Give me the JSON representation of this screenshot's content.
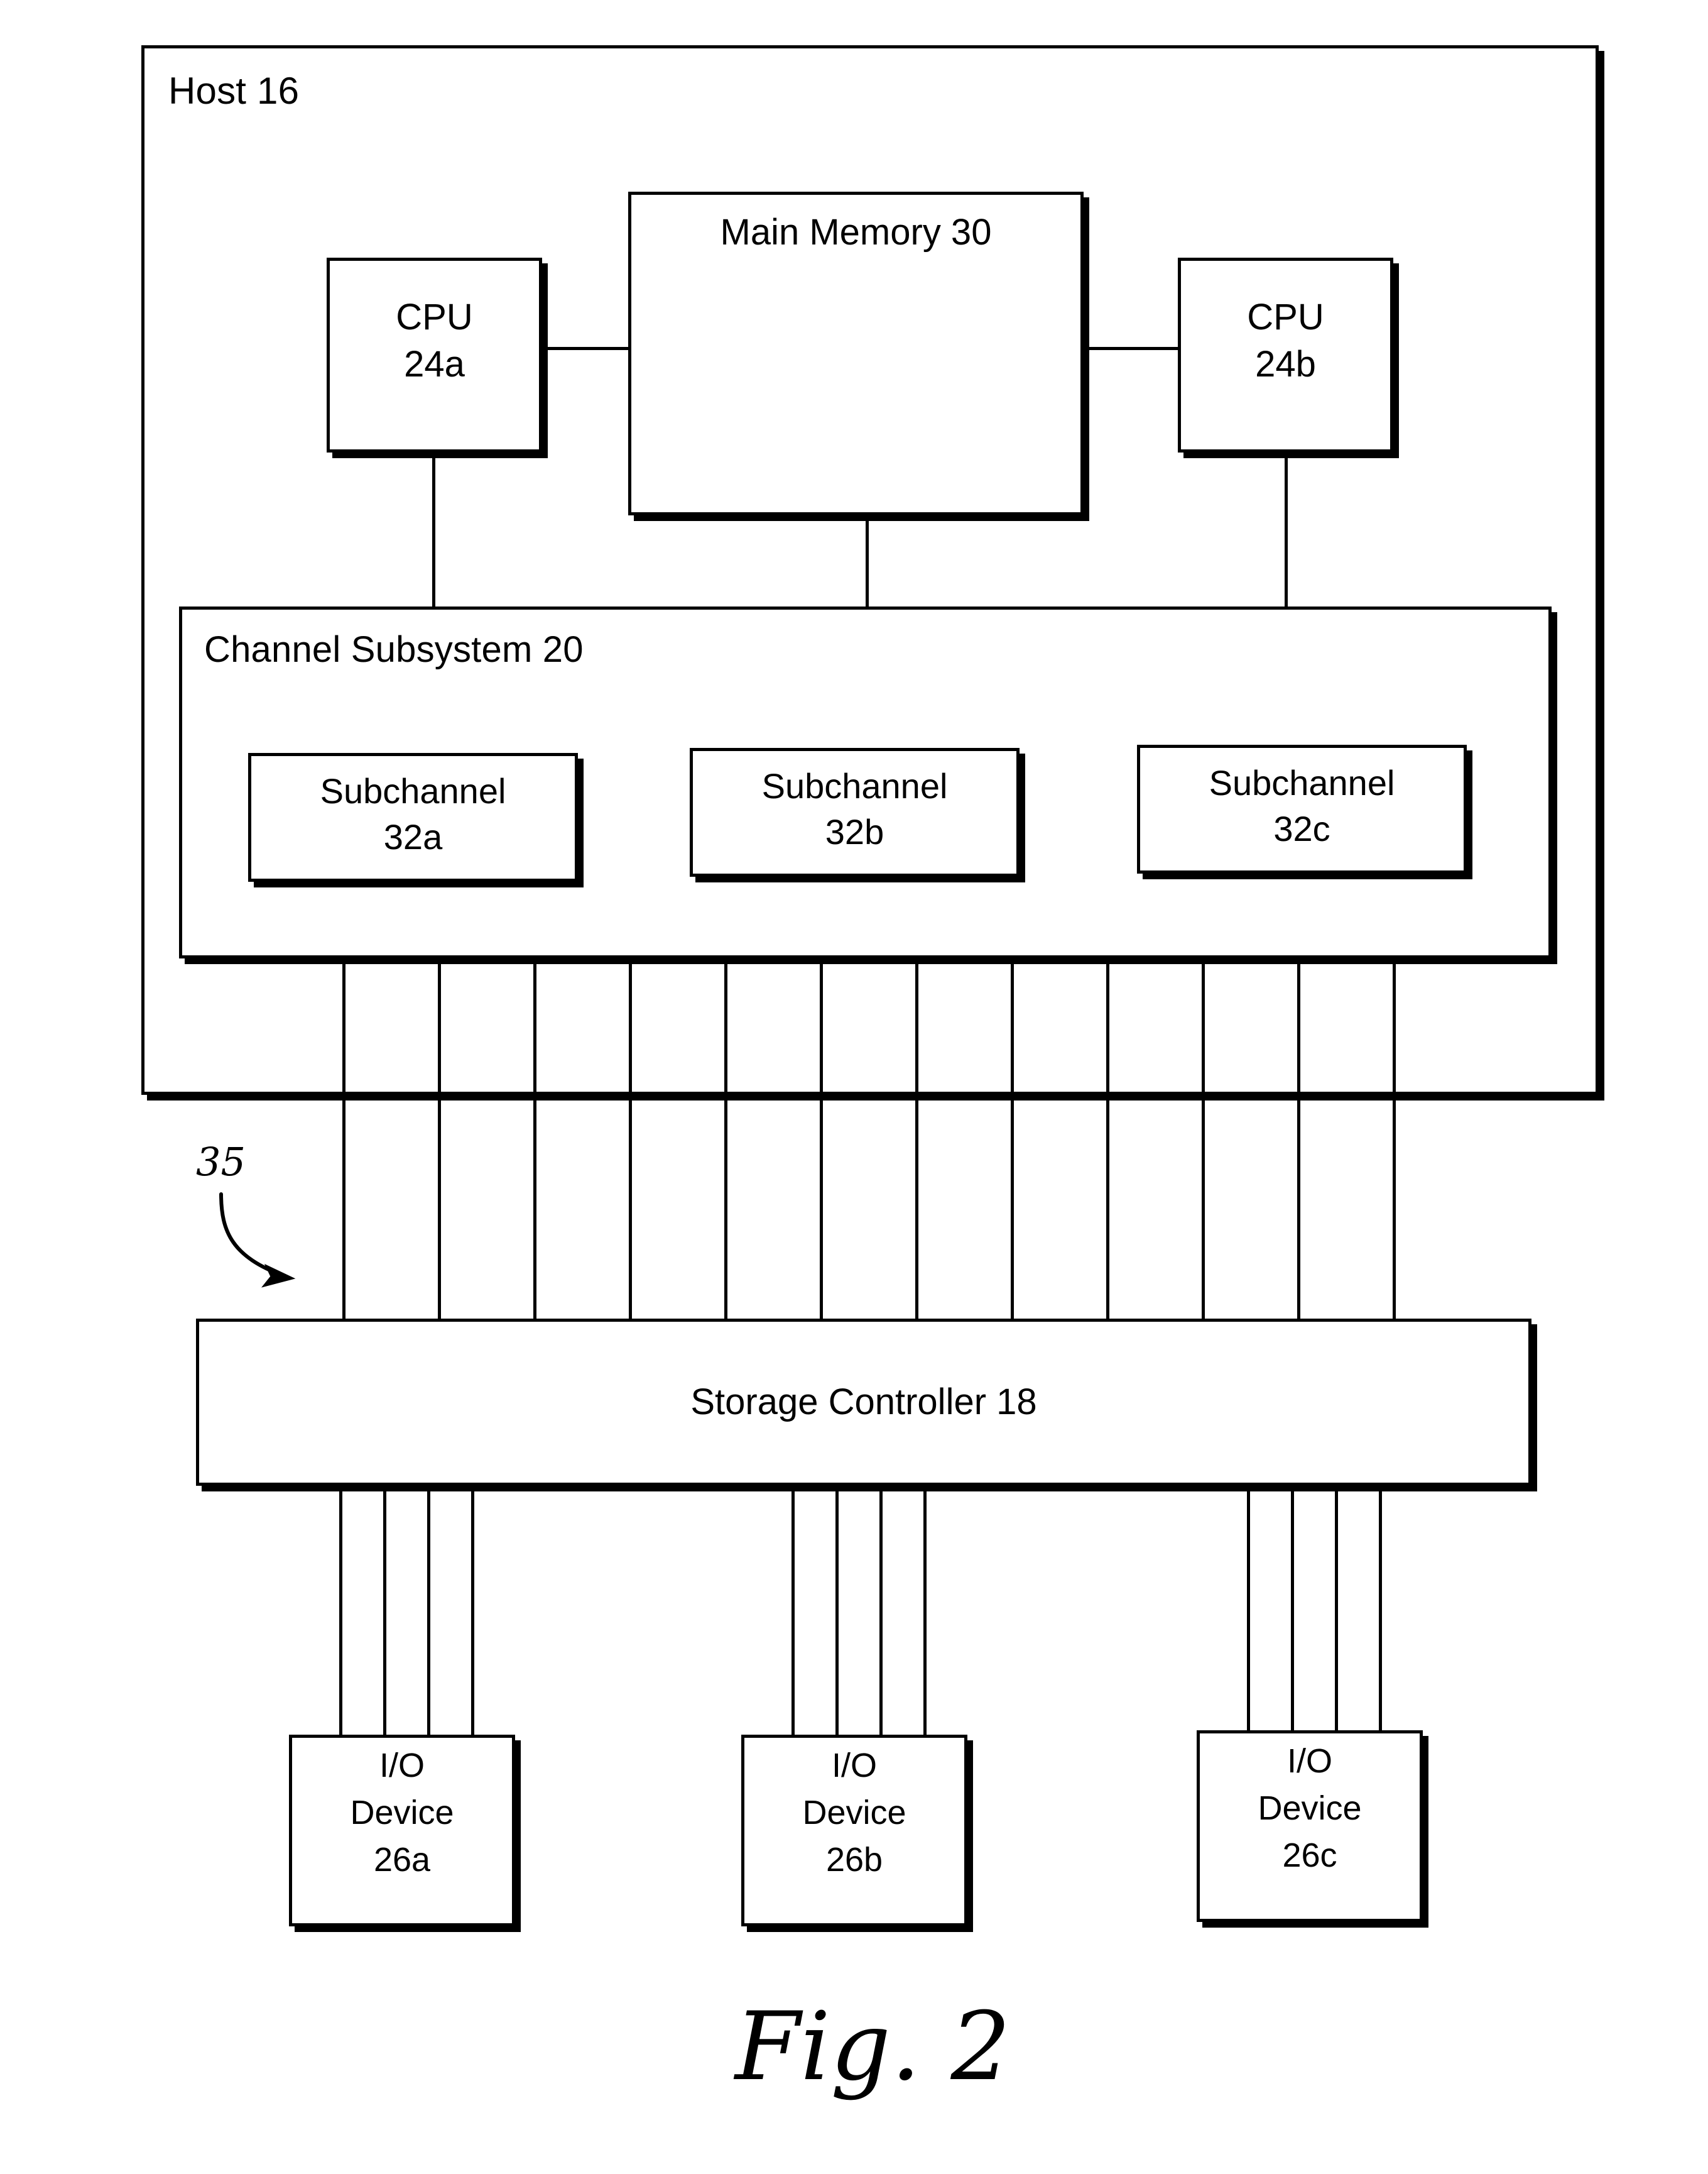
{
  "figure": {
    "caption": "Fig. 2",
    "host": {
      "title": "Host 16"
    },
    "cpus": [
      {
        "line1": "CPU",
        "line2": "24a"
      },
      {
        "line1": "CPU",
        "line2": "24b"
      }
    ],
    "main_memory": {
      "title": "Main Memory 30"
    },
    "channel_subsystem": {
      "title": "Channel Subsystem 20",
      "subchannels": [
        {
          "line1": "Subchannel",
          "line2": "32a"
        },
        {
          "line1": "Subchannel",
          "line2": "32b"
        },
        {
          "line1": "Subchannel",
          "line2": "32c"
        }
      ]
    },
    "bus_reference": {
      "label": "35"
    },
    "storage_controller": {
      "title": "Storage Controller 18"
    },
    "io_devices": [
      {
        "line1": "I/O",
        "line2": "Device",
        "line3": "26a"
      },
      {
        "line1": "I/O",
        "line2": "Device",
        "line3": "26b"
      },
      {
        "line1": "I/O",
        "line2": "Device",
        "line3": "26c"
      }
    ],
    "colors": {
      "ink": "#000000",
      "paper": "#ffffff"
    }
  }
}
